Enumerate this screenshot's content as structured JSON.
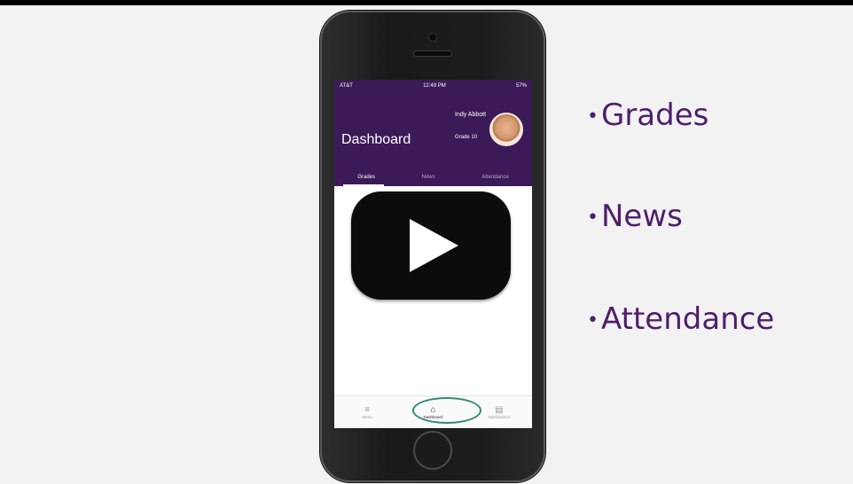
{
  "status_bar": {
    "carrier": "AT&T",
    "time": "12:49 PM",
    "battery": "57%"
  },
  "header": {
    "title": "Dashboard",
    "user_name": "Indy Abbott",
    "user_grade": "Grade 10"
  },
  "tabs": [
    {
      "label": "Grades",
      "active": true
    },
    {
      "label": "News",
      "active": false
    },
    {
      "label": "Attendance",
      "active": false
    }
  ],
  "bottom_nav": [
    {
      "label": "Menu",
      "icon": "menu-icon",
      "glyph": "≡",
      "active": false
    },
    {
      "label": "Dashboard",
      "icon": "home-icon",
      "glyph": "⌂",
      "active": true
    },
    {
      "label": "Notifications",
      "icon": "notifications-icon",
      "glyph": "▤",
      "active": false
    }
  ],
  "bullets": [
    "Grades",
    "News",
    "Attendance"
  ],
  "colors": {
    "brand": "#3b1a57",
    "bullet_text": "#4e1e6c",
    "highlight_ring": "#2e8b74"
  }
}
